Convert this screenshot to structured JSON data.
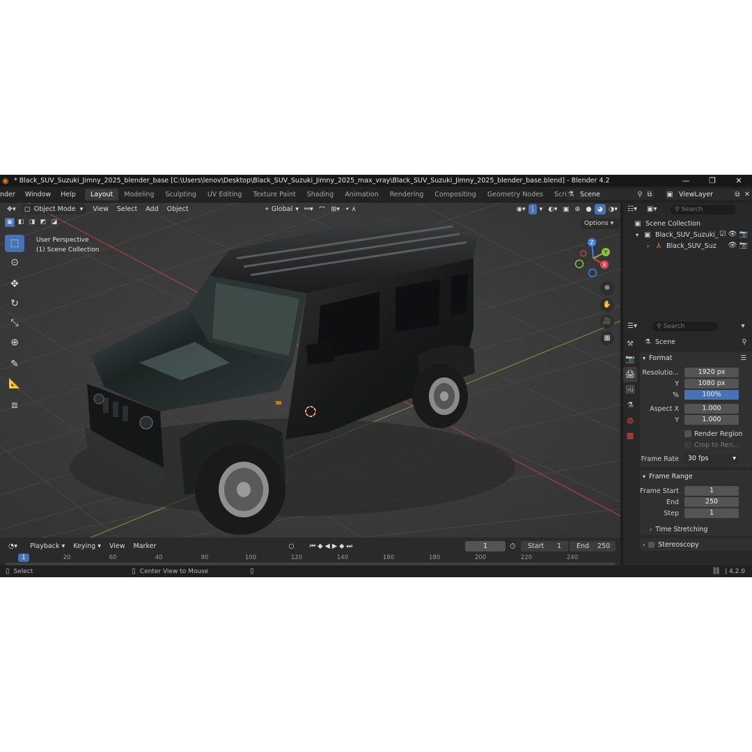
{
  "window": {
    "title": "* Black_SUV_Suzuki_Jimny_2025_blender_base [C:\\Users\\lenov\\Desktop\\Black_SUV_Suzuki_Jimny_2025_max_vray\\Black_SUV_Suzuki_Jimny_2025_blender_base.blend] - Blender 4.2",
    "minimize": "—",
    "maximize": "❐",
    "close": "✕"
  },
  "menubar": {
    "menus": [
      "nder",
      "Window",
      "Help"
    ],
    "workspaces": [
      "Layout",
      "Modeling",
      "Sculpting",
      "UV Editing",
      "Texture Paint",
      "Shading",
      "Animation",
      "Rendering",
      "Compositing",
      "Geometry Nodes",
      "Scripting"
    ],
    "active_workspace": "Layout",
    "add_workspace": "+",
    "scene": "Scene",
    "view_layer": "ViewLayer"
  },
  "viewport": {
    "mode": "Object Mode",
    "menus": [
      "View",
      "Select",
      "Add",
      "Object"
    ],
    "transform_orientation": "Global",
    "options": "Options",
    "info_line1": "User Perspective",
    "info_line2": "(1) Scene Collection",
    "gizmo_axes": {
      "x": "X",
      "y": "Y",
      "z": "Z"
    },
    "colors": {
      "x_axis": "#e2434e",
      "y_axis": "#8bc53f",
      "z_axis": "#3d84e6",
      "grid": "#4a4a4a",
      "background": "#393939"
    }
  },
  "timeline": {
    "menus": [
      "Playback",
      "Keying",
      "View",
      "Marker"
    ],
    "current_frame": "1",
    "start_label": "Start",
    "start_value": "1",
    "end_label": "End",
    "end_value": "250",
    "ruler_ticks": [
      "1",
      "20",
      "60",
      "40",
      "80",
      "100",
      "120",
      "140",
      "160",
      "180",
      "200",
      "220",
      "240"
    ]
  },
  "statusbar": {
    "select": "Select",
    "center_view": "Center View to Mouse",
    "version": "4.2.0"
  },
  "outliner": {
    "search_placeholder": "Search",
    "rows": [
      {
        "label": "Scene Collection"
      },
      {
        "label": "Black_SUV_Suzuki_"
      },
      {
        "label": "Black_SUV_Suz"
      }
    ]
  },
  "properties": {
    "search_placeholder": "Search",
    "context": "Scene",
    "format": {
      "title": "Format",
      "resolution_x_label": "Resolutio...",
      "resolution_x": "1920 px",
      "resolution_y_label": "Y",
      "resolution_y": "1080 px",
      "percent_label": "%",
      "percent": "100%",
      "aspect_x_label": "Aspect X",
      "aspect_x": "1.000",
      "aspect_y_label": "Y",
      "aspect_y": "1.000",
      "render_region": "Render Region",
      "crop_to_render": "Crop to Ren...",
      "frame_rate_label": "Frame Rate",
      "frame_rate": "30 fps"
    },
    "frame_range": {
      "title": "Frame Range",
      "start_label": "Frame Start",
      "start": "1",
      "end_label": "End",
      "end": "250",
      "step_label": "Step",
      "step": "1",
      "time_stretching": "Time Stretching"
    },
    "stereoscopy": "Stereoscopy"
  }
}
